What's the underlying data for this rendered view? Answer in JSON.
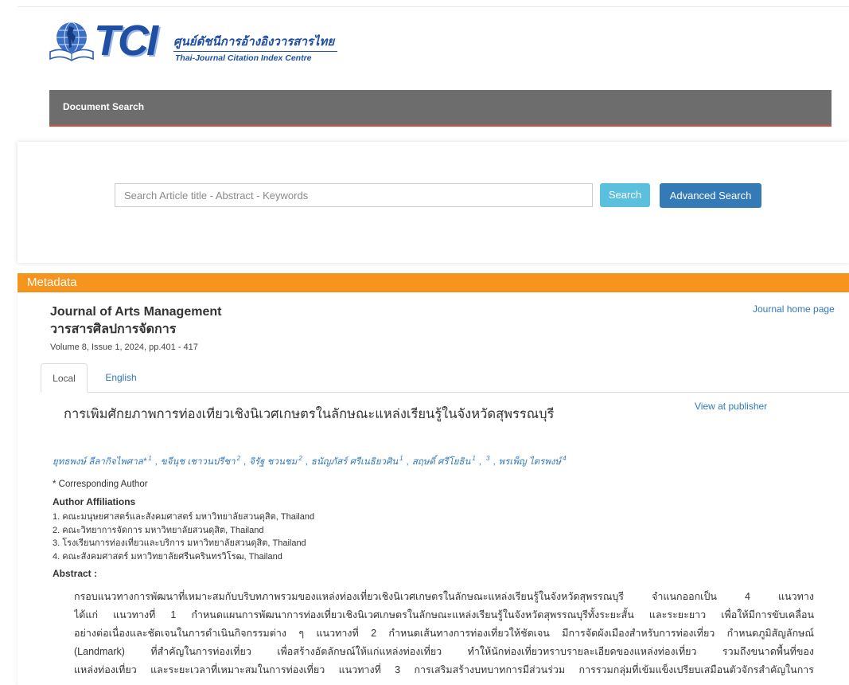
{
  "header": {
    "logo_text": "TCI",
    "center_name_th": "ศูนย์ดัชนีการอ้างอิงวารสารไทย",
    "center_name_en": "Thai-Journal Citation Index Centre"
  },
  "nav": {
    "items": [
      {
        "label": "Document Search"
      }
    ]
  },
  "search": {
    "placeholder": "Search Article title - Abstract - Keywords",
    "value": "",
    "search_label": "Search",
    "advanced_label": "Advanced Search"
  },
  "metadata": {
    "section_title": "Metadata",
    "journal_name_en": "Journal of Arts Management",
    "journal_name_th": "วารสารศิลปการจัดการ",
    "volume_info": "Volume 8, Issue 1, 2024, pp.401 - 417",
    "journal_home_label": "Journal home page",
    "tabs": [
      {
        "label": "Local",
        "active": true
      },
      {
        "label": "English",
        "active": false
      }
    ],
    "article_title": "การเพิ่มศักยภาพการท่องเที่ยวเชิงนิเวศเกษตรในลักษณะแหล่งเรียนรู้ในจังหวัดสุพรรณบุรี",
    "view_publisher_label": "View at publisher",
    "author_separator": ",",
    "authors": [
      {
        "name": "ยุทธพงษ์ ลีลากิจไพศาล*",
        "affils": [
          "1"
        ]
      },
      {
        "name": "ขจีนุช เชาวนปรีชา",
        "affils": [
          "2"
        ]
      },
      {
        "name": "จิรัฐ ชวนชม",
        "affils": [
          "2"
        ]
      },
      {
        "name": "ธนัญภัสร์ ศรีเนธิยวศิน",
        "affils": [
          "1"
        ]
      },
      {
        "name": "สฤษดิ์ ศรีโยธิน",
        "affils": [
          "1",
          "3"
        ]
      },
      {
        "name": "พรเพ็ญ ไตรพงษ์",
        "affils": [
          "4"
        ]
      }
    ],
    "corresponding_note": "* Corresponding Author",
    "affiliations_title": "Author Affiliations",
    "affiliations": [
      {
        "number": "1.",
        "text": "คณะมนุษยศาสตร์และสังคมศาสตร์ มหาวิทยาลัยสวนดุสิต, Thailand"
      },
      {
        "number": "2.",
        "text": "คณะวิทยาการจัดการ มหาวิทยาลัยสวนดุสิต, Thailand"
      },
      {
        "number": "3.",
        "text": "โรงเรียนการท่องเที่ยวและบริการ มหาวิทยาลัยสวนดุสิต, Thailand"
      },
      {
        "number": "4.",
        "text": "คณะสังคมศาสตร์ มหาวิทยาลัยศรีนครินทรวิโรฒ, Thailand"
      }
    ],
    "abstract_label": "Abstract :",
    "abstract_lines": [
      "กรอบแนวทางการพัฒนาที่เหมาะสมกับบริบทภาพรวมของแหล่งท่องเที่ยวเชิงนิเวศเกษตรในลักษณะแหล่งเรียนรู้ในจังหวัดสุพรรณบุรี จำแนกออกเป็น 4 แนวทาง",
      "ได้แก่ แนวทางที่ 1 กำหนดแผนการพัฒนาการท่องเที่ยวเชิงนิเวศเกษตรในลักษณะแหล่งเรียนรู้ในจังหวัดสุพรรณบุรีทั้งระยะสั้น และระยะยาว เพื่อให้มีการขับเคลื่อน",
      "อย่างต่อเนื่องและชัดเจนในการดำเนินกิจกรรมต่าง ๆ แนวทางที่ 2 กำหนดเส้นทางการท่องเที่ยวให้ชัดเจน มีการจัดผังเมืองสำหรับการท่องเที่ยว กำหนดภูมิสัญลักษณ์",
      "(Landmark) ที่สำคัญในการท่องเที่ยว เพื่อสร้างอัตลักษณ์ให้แก่แหล่งท่องเที่ยว ทำให้นักท่องเที่ยวทราบรายละเอียดของแหล่งท่องเที่ยว รวมถึงขนาดพื้นที่ของ",
      "แหล่งท่องเที่ยว และระยะเวลาที่เหมาะสมในการท่องเที่ยว แนวทางที่ 3 การเสริมสร้างบทบาทการมีส่วนร่วม การรวมกลุ่มที่เข้มแข็งเปรียบเสมือนตัวจักรสำคัญในการ"
    ]
  },
  "icons": {
    "logo_emblem": "globe-book-icon"
  },
  "colors": {
    "logo_blue": "#1f4fa3",
    "nav_bg": "#6d6d6d",
    "nav_underline": "#e04a3c",
    "search_button": "#5bc0de",
    "advanced_button": "#337ab7",
    "metadata_bar": "#f7941d",
    "link": "#337ab7"
  }
}
